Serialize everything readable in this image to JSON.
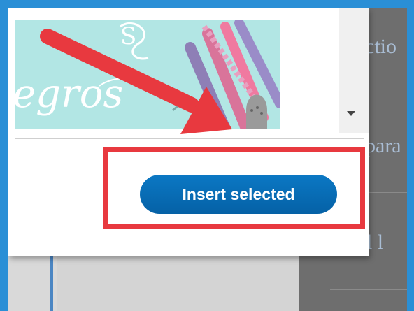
{
  "modal": {
    "insert_button_label": "Insert selected",
    "thumbnail_text": "egros",
    "thumbnail_small_text": "S"
  },
  "background_panel": {
    "labels": [
      "ctio",
      "para",
      "ocial l"
    ]
  },
  "annotation": {
    "color": "#e8393f",
    "type": "arrow-and-box"
  },
  "colors": {
    "frame": "#2a8fd6",
    "button": "#0b78c4",
    "thumbnail_bg": "#b2e6e4"
  }
}
